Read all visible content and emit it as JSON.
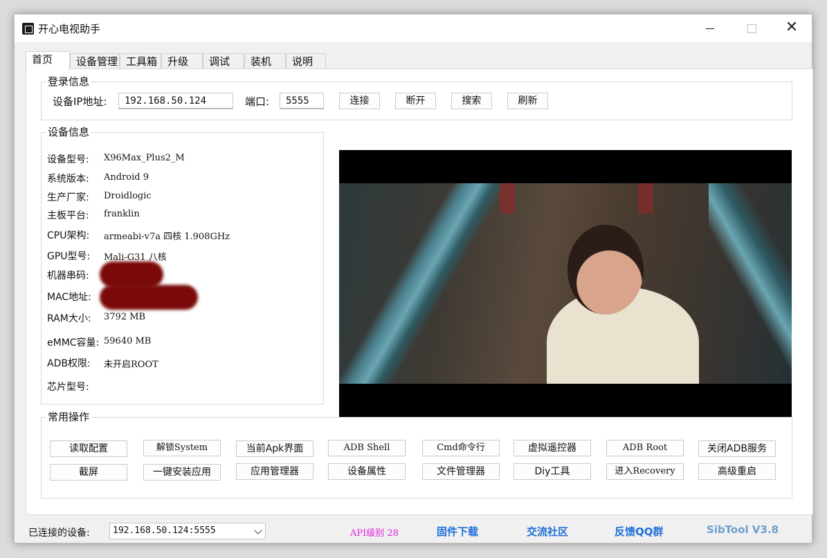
{
  "window": {
    "title": "开心电视助手"
  },
  "tabs": [
    "首页",
    "设备管理",
    "工具箱",
    "升级",
    "调试",
    "装机",
    "说明"
  ],
  "login": {
    "group_title": "登录信息",
    "ip_label": "设备IP地址:",
    "ip_value": "192.168.50.124",
    "port_label": "端口:",
    "port_value": "5555",
    "buttons": {
      "connect": "连接",
      "disconnect": "断开",
      "search": "搜索",
      "refresh": "刷新"
    }
  },
  "device_info": {
    "group_title": "设备信息",
    "rows": [
      {
        "label": "设备型号:",
        "value": "X96Max_Plus2_M"
      },
      {
        "label": "系统版本:",
        "value": "Android 9"
      },
      {
        "label": "生产厂家:",
        "value": "Droidlogic"
      },
      {
        "label": "主板平台:",
        "value": "franklin"
      },
      {
        "label": "CPU架构:",
        "value": "armeabi-v7a 四核 1.908GHz"
      },
      {
        "label": "GPU型号:",
        "value": "Mali-G31 八核"
      },
      {
        "label": "机器串码:",
        "value": ""
      },
      {
        "label": "MAC地址:",
        "value": ""
      },
      {
        "label": "RAM大小:",
        "value": "3792 MB"
      },
      {
        "label": "eMMC容量:",
        "value": "59640 MB"
      },
      {
        "label": "ADB权限:",
        "value": "未开启ROOT"
      },
      {
        "label": "芯片型号:",
        "value": ""
      }
    ]
  },
  "operations": {
    "group_title": "常用操作",
    "row1": [
      "读取配置",
      "解锁System",
      "当前Apk界面",
      "ADB Shell",
      "Cmd命令行",
      "虚拟遥控器",
      "ADB  Root",
      "关闭ADB服务"
    ],
    "row2": [
      "截屏",
      "一键安装应用",
      "应用管理器",
      "设备属性",
      "文件管理器",
      "Diy工具",
      "进入Recovery",
      "高级重启"
    ]
  },
  "status": {
    "connected_label": "已连接的设备:",
    "connected_value": "192.168.50.124:5555",
    "api_level": "API级别 28",
    "firmware_link": "固件下载",
    "community_link": "交流社区",
    "qq_link": "反馈QQ群",
    "version": "SibTool V3.8"
  },
  "colors": {
    "api": "#e01ee0",
    "link": "#1e6fd9",
    "redaction": "#7a0a0a"
  }
}
